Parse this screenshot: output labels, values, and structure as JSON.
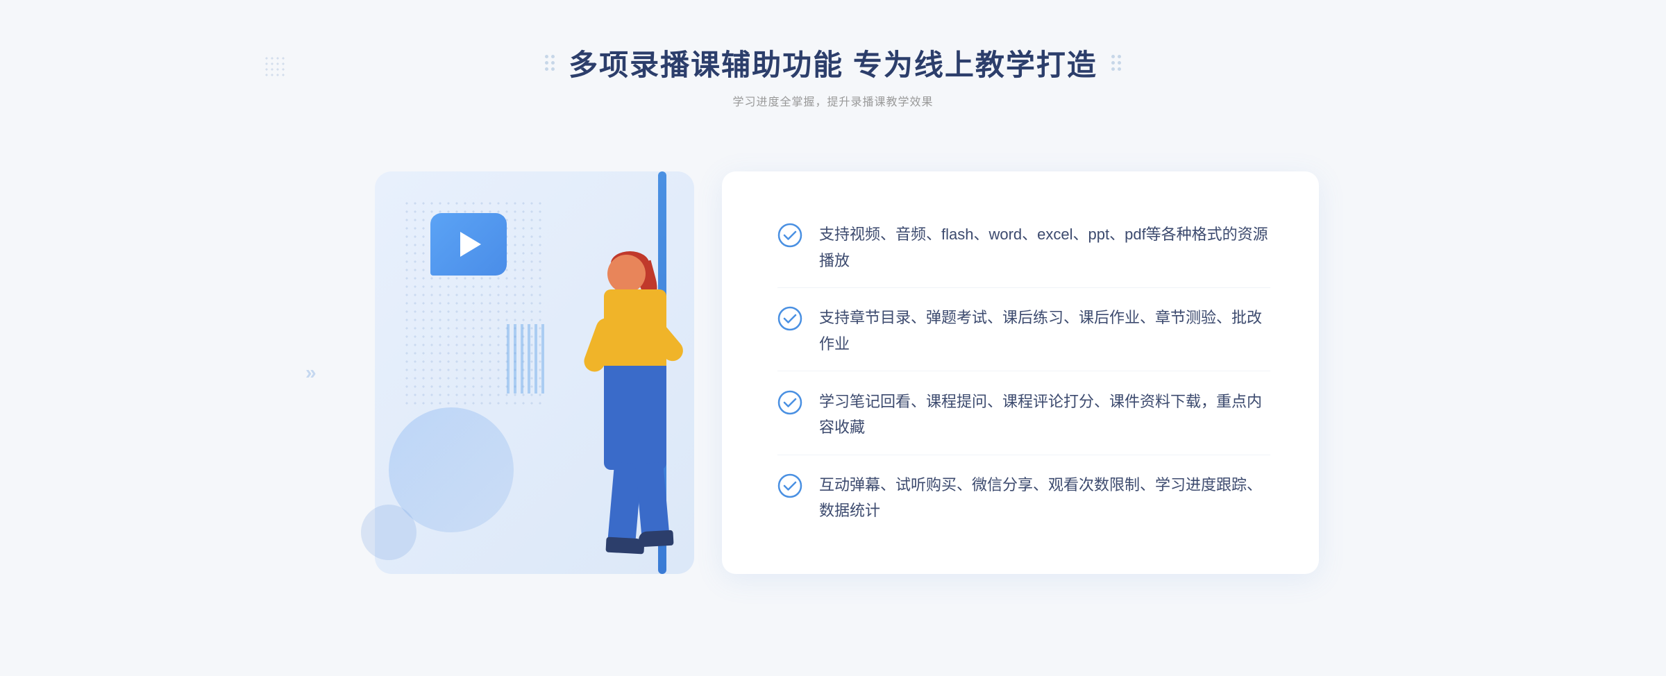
{
  "header": {
    "main_title": "多项录播课辅助功能 专为线上教学打造",
    "subtitle": "学习进度全掌握，提升录播课教学效果"
  },
  "features": [
    {
      "id": "feature-1",
      "text": "支持视频、音频、flash、word、excel、ppt、pdf等各种格式的资源播放"
    },
    {
      "id": "feature-2",
      "text": "支持章节目录、弹题考试、课后练习、课后作业、章节测验、批改作业"
    },
    {
      "id": "feature-3",
      "text": "学习笔记回看、课程提问、课程评论打分、课件资料下载，重点内容收藏"
    },
    {
      "id": "feature-4",
      "text": "互动弹幕、试听购买、微信分享、观看次数限制、学习进度跟踪、数据统计"
    }
  ],
  "decorative": {
    "left_arrows": "»",
    "play_label": "play-icon"
  }
}
